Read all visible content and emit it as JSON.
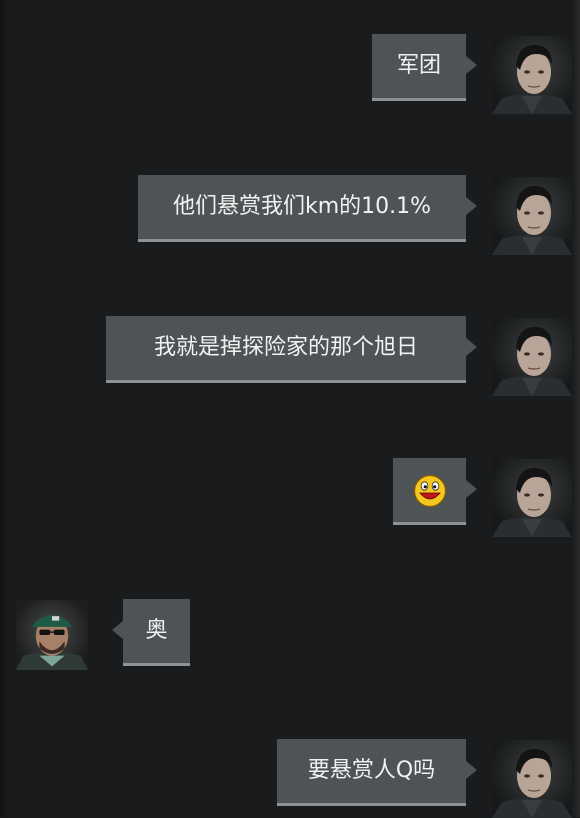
{
  "messages": [
    {
      "side": "right",
      "type": "text",
      "text": "军团",
      "avatar": "officer-portrait-icon"
    },
    {
      "side": "right",
      "type": "text",
      "text": "他们悬赏我们km的10.1%",
      "avatar": "officer-portrait-icon"
    },
    {
      "side": "right",
      "type": "text",
      "text": "我就是掉探险家的那个旭日",
      "avatar": "officer-portrait-icon"
    },
    {
      "side": "right",
      "type": "emoji",
      "emoji": "grinning-face-icon",
      "avatar": "officer-portrait-icon"
    },
    {
      "side": "left",
      "type": "text",
      "text": "奥",
      "avatar": "cap-sunglasses-portrait-icon"
    },
    {
      "side": "right",
      "type": "text",
      "text": "要悬赏人Q吗",
      "avatar": "officer-portrait-icon"
    }
  ],
  "colors": {
    "background": "#1a1b1d",
    "bubble": "#4e5456",
    "bubble_border": "#8d9294",
    "text": "#f2f2f2"
  }
}
